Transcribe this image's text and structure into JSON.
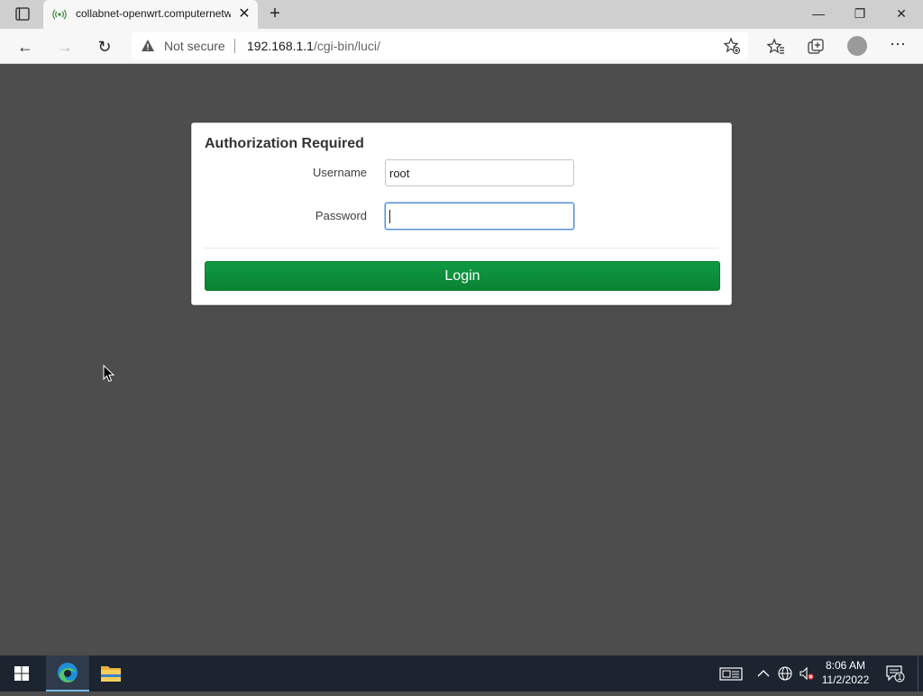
{
  "browser": {
    "tab": {
      "title": "collabnet-openwrt.computernetw",
      "close": "✕"
    },
    "new_tab": "+",
    "window": {
      "minimize": "—",
      "maximize": "❐",
      "close": "✕"
    },
    "toolbar": {
      "back": "←",
      "forward": "→",
      "refresh": "↻",
      "more": "···"
    },
    "address": {
      "security": "Not secure",
      "host": "192.168.1.1",
      "path": "/cgi-bin/luci/"
    }
  },
  "login": {
    "title": "Authorization Required",
    "username_label": "Username",
    "username_value": "root",
    "password_label": "Password",
    "password_value": "",
    "button": "Login"
  },
  "taskbar": {
    "time": "8:06 AM",
    "date": "11/2/2022",
    "notification_count": "1"
  },
  "colors": {
    "login_button": "#0a8a3a",
    "page_bg": "#4d4d4d",
    "taskbar_bg": "#1c2430"
  },
  "icons": [
    "tab-actions-icon",
    "wifi-icon",
    "close-icon",
    "plus-icon",
    "back-icon",
    "forward-icon",
    "refresh-icon",
    "warning-icon",
    "add-favorite-icon",
    "favorites-icon",
    "collections-icon",
    "profile-icon",
    "more-icon",
    "windows-start-icon",
    "edge-icon",
    "file-explorer-icon",
    "keyboard-icon",
    "chevron-up-icon",
    "network-icon",
    "speaker-muted-icon",
    "notification-icon"
  ]
}
